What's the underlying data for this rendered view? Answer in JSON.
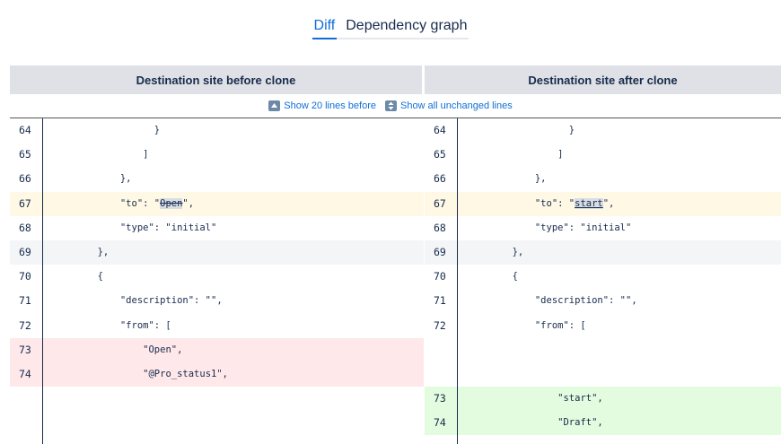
{
  "tabs": [
    {
      "label": "Diff",
      "active": true
    },
    {
      "label": "Dependency graph",
      "active": false
    }
  ],
  "headers": {
    "left": "Destination site before clone",
    "right": "Destination site after clone"
  },
  "show_bar": {
    "before_label": "Show 20 lines before",
    "all_label": "Show all unchanged lines"
  },
  "left_rows": [
    {
      "num": "64",
      "indent": "                  ",
      "text": "}",
      "hl": ""
    },
    {
      "num": "65",
      "indent": "                ",
      "text": "]",
      "hl": ""
    },
    {
      "num": "66",
      "indent": "            ",
      "text": "},",
      "hl": ""
    },
    {
      "num": "67",
      "indent": "            ",
      "pre": "\"to\": \"",
      "changed": "Open",
      "post": "\",",
      "hl": "yellow",
      "change": "del"
    },
    {
      "num": "68",
      "indent": "            ",
      "text": "\"type\": \"initial\"",
      "hl": ""
    },
    {
      "num": "69",
      "indent": "        ",
      "text": "},",
      "hl": "grey"
    },
    {
      "num": "70",
      "indent": "        ",
      "text": "{",
      "hl": ""
    },
    {
      "num": "71",
      "indent": "            ",
      "text": "\"description\": \"\",",
      "hl": ""
    },
    {
      "num": "72",
      "indent": "            ",
      "text": "\"from\": [",
      "hl": ""
    },
    {
      "num": "73",
      "indent": "                ",
      "text": "\"Open\",",
      "hl": "red"
    },
    {
      "num": "74",
      "indent": "                ",
      "text": "\"@Pro_status1\",",
      "hl": "red"
    }
  ],
  "right_rows": [
    {
      "num": "64",
      "indent": "                  ",
      "text": "}",
      "hl": ""
    },
    {
      "num": "65",
      "indent": "                ",
      "text": "]",
      "hl": ""
    },
    {
      "num": "66",
      "indent": "            ",
      "text": "},",
      "hl": ""
    },
    {
      "num": "67",
      "indent": "            ",
      "pre": "\"to\": \"",
      "changed": "start",
      "post": "\",",
      "hl": "yellow",
      "change": "ins"
    },
    {
      "num": "68",
      "indent": "            ",
      "text": "\"type\": \"initial\"",
      "hl": ""
    },
    {
      "num": "69",
      "indent": "        ",
      "text": "},",
      "hl": "grey"
    },
    {
      "num": "70",
      "indent": "        ",
      "text": "{",
      "hl": ""
    },
    {
      "num": "71",
      "indent": "            ",
      "text": "\"description\": \"\",",
      "hl": ""
    },
    {
      "num": "72",
      "indent": "            ",
      "text": "\"from\": [",
      "hl": ""
    },
    {
      "num": "",
      "indent": "",
      "text": "",
      "hl": ""
    },
    {
      "num": "",
      "indent": "",
      "text": "",
      "hl": ""
    },
    {
      "num": "73",
      "indent": "                ",
      "text": "\"start\",",
      "hl": "green"
    },
    {
      "num": "74",
      "indent": "                ",
      "text": "\"Draft\",",
      "hl": "green"
    }
  ],
  "colors": {
    "accent": "#0f6fd6",
    "changed_line": "#fff8e5",
    "removed_line": "#ffe8ea",
    "added_line": "#e3fcdf",
    "context_line": "#f4f5f7"
  },
  "icons": [
    "expand-up-icon",
    "expand-all-icon"
  ]
}
